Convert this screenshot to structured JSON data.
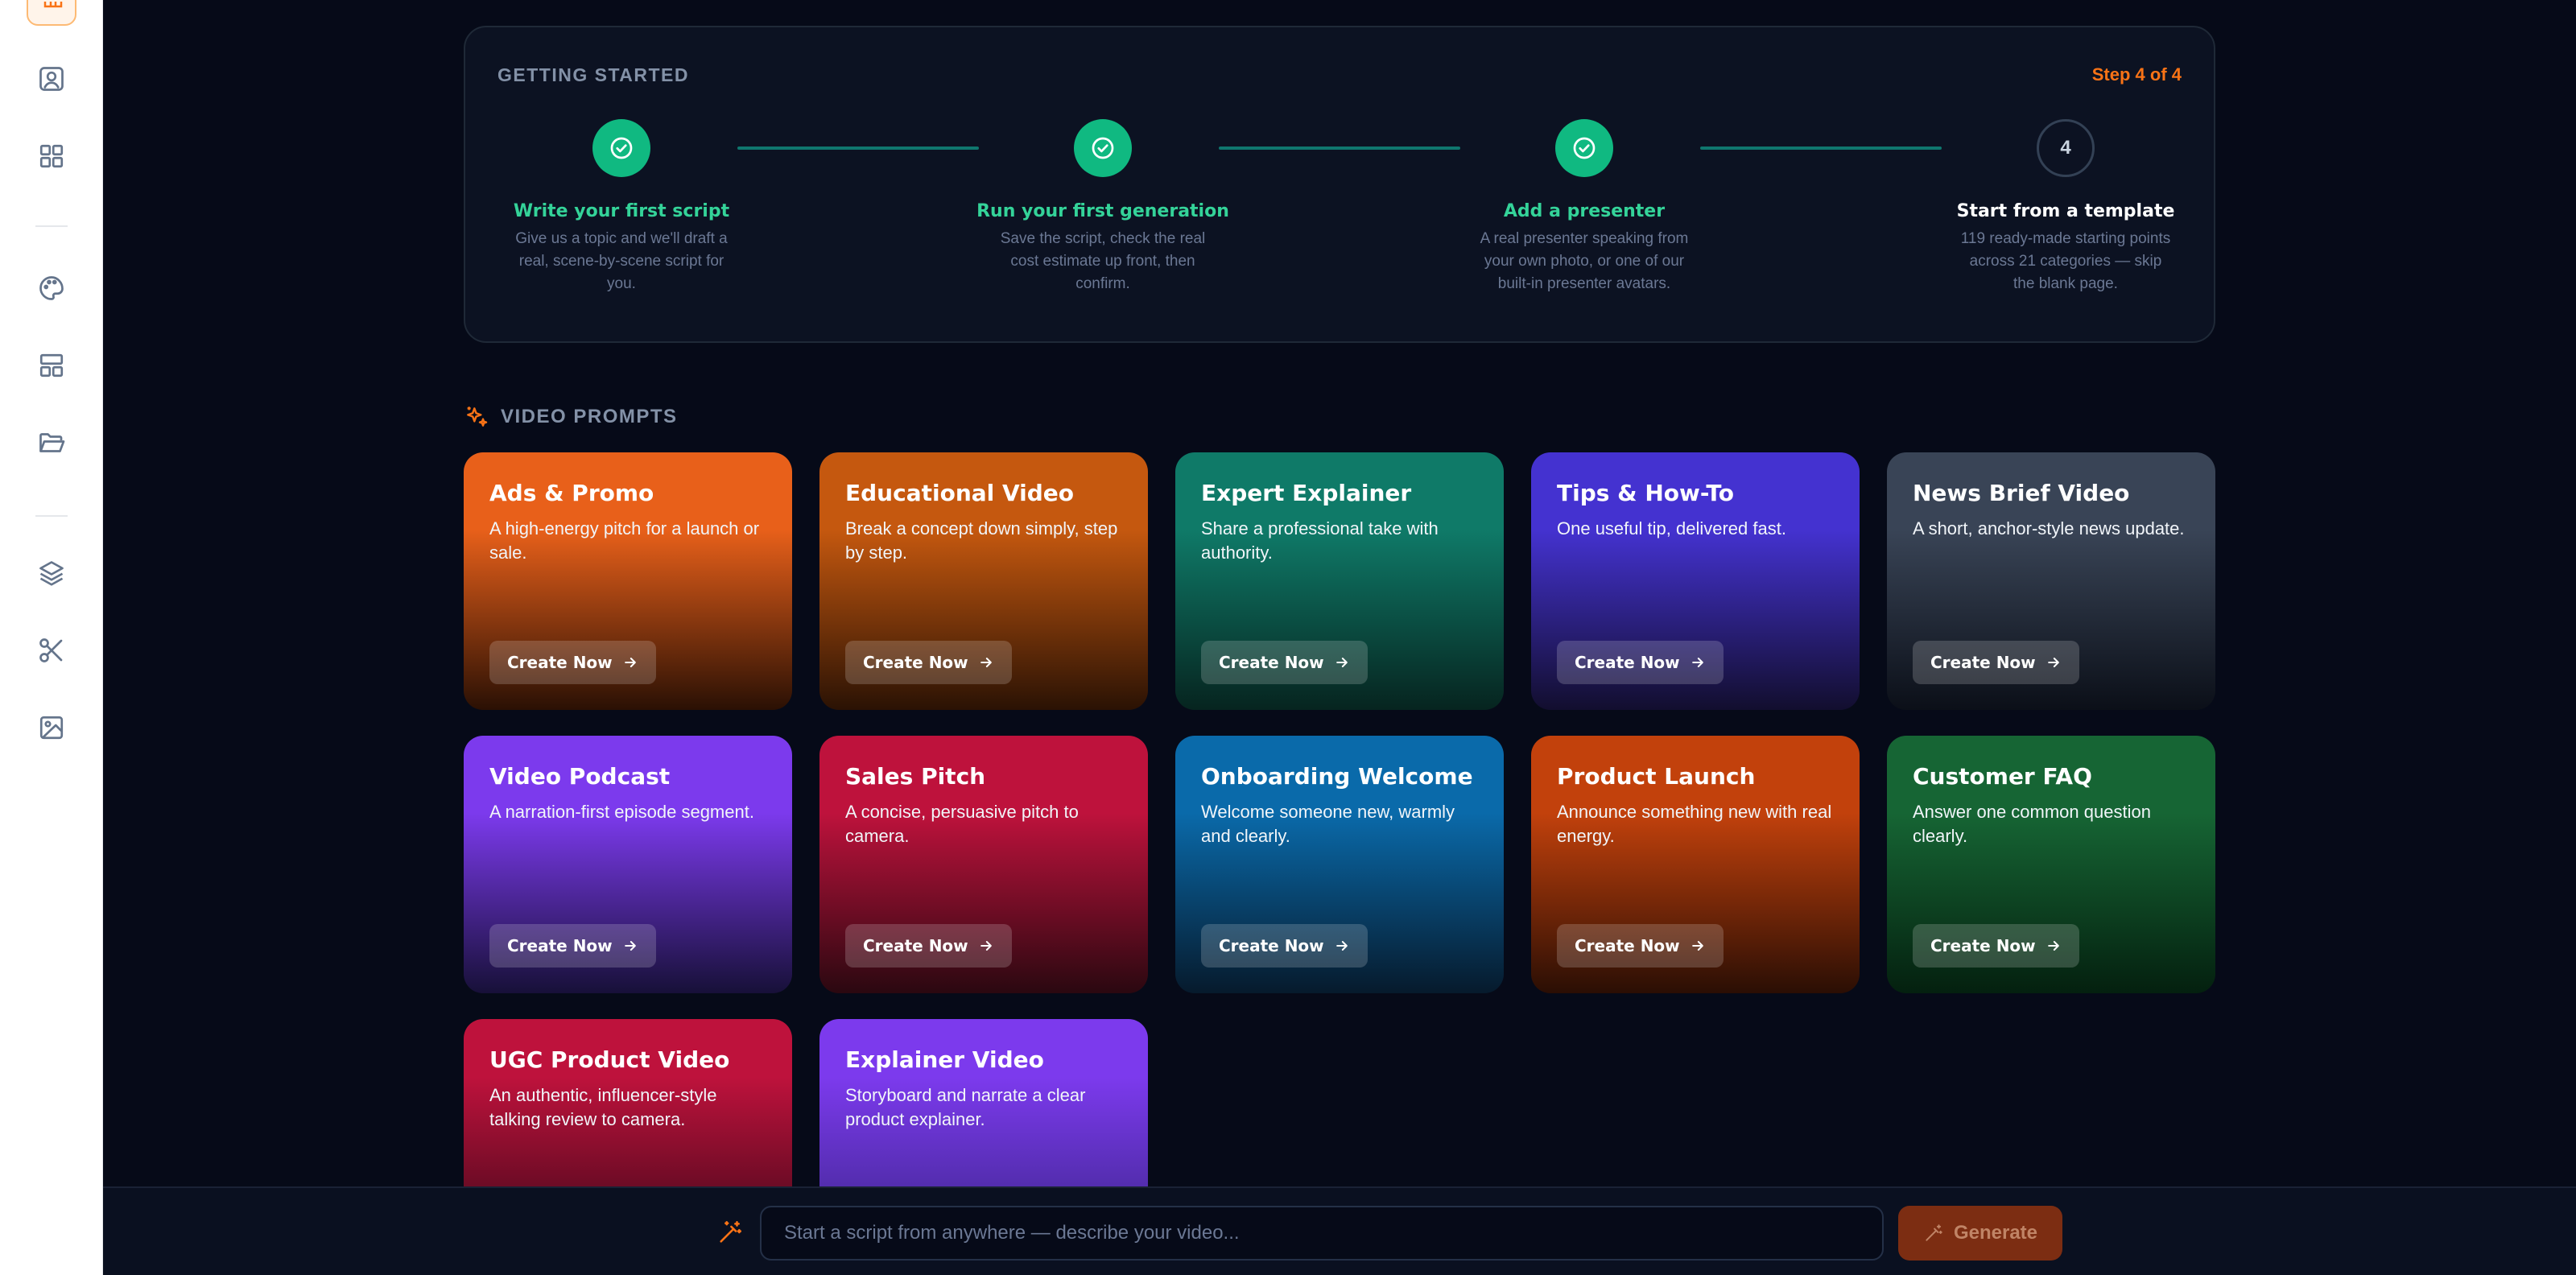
{
  "getting_started": {
    "title": "GETTING STARTED",
    "step_indicator": "Step 4 of 4",
    "steps": [
      {
        "label": "Write your first script",
        "desc": "Give us a topic and we'll draft a real, scene-by-scene script for you.",
        "status": "done"
      },
      {
        "label": "Run your first generation",
        "desc": "Save the script, check the real cost estimate up front, then confirm.",
        "status": "done"
      },
      {
        "label": "Add a presenter",
        "desc": "A real presenter speaking from your own photo, or one of our built-in presenter avatars.",
        "status": "done"
      },
      {
        "label": "Start from a template",
        "desc": "119 ready-made starting points across 21 categories — skip the blank page.",
        "status": "pending",
        "number": "4"
      }
    ]
  },
  "video_prompts": {
    "title": "VIDEO PROMPTS",
    "button_label": "Create Now",
    "cards": [
      {
        "title": "Ads & Promo",
        "desc": "A high-energy pitch for a launch or sale.",
        "color_top": "#e8601a",
        "color_bottom": "#2a1004"
      },
      {
        "title": "Educational Video",
        "desc": "Break a concept down simply, step by step.",
        "color_top": "#c5580f",
        "color_bottom": "#2a1204"
      },
      {
        "title": "Expert Explainer",
        "desc": "Share a professional take with authority.",
        "color_top": "#0f7a68",
        "color_bottom": "#06241f"
      },
      {
        "title": "Tips & How-To",
        "desc": "One useful tip, delivered fast.",
        "color_top": "#4432d0",
        "color_bottom": "#120e2e"
      },
      {
        "title": "News Brief Video",
        "desc": "A short, anchor-style news update.",
        "color_top": "#394456",
        "color_bottom": "#0b0f18"
      },
      {
        "title": "Video Podcast",
        "desc": "A narration-first episode segment.",
        "color_top": "#7c3aed",
        "color_bottom": "#171038"
      },
      {
        "title": "Sales Pitch",
        "desc": "A concise, persuasive pitch to camera.",
        "color_top": "#be123c",
        "color_bottom": "#2a0810"
      },
      {
        "title": "Onboarding Welcome",
        "desc": "Welcome someone new, warmly and clearly.",
        "color_top": "#0a6aaa",
        "color_bottom": "#061a2c"
      },
      {
        "title": "Product Launch",
        "desc": "Announce something new with real energy.",
        "color_top": "#c2410c",
        "color_bottom": "#2a0e04"
      },
      {
        "title": "Customer FAQ",
        "desc": "Answer one common question clearly.",
        "color_top": "#166534",
        "color_bottom": "#04200f"
      },
      {
        "title": "UGC Product Video",
        "desc": "An authentic, influencer-style talking review to camera.",
        "color_top": "#be123c",
        "color_bottom": "#5a0a20"
      },
      {
        "title": "Explainer Video",
        "desc": "Storyboard and narrate a clear product explainer.",
        "color_top": "#7c3aed",
        "color_bottom": "#4a2aa0"
      }
    ]
  },
  "bottom_bar": {
    "placeholder": "Start a script from anywhere — describe your video...",
    "generate_label": "Generate"
  },
  "sidebar": {
    "icons": [
      "grid-icon",
      "user-square-icon",
      "apps-icon",
      "palette-icon",
      "layout-icon",
      "folder-open-icon",
      "layers-icon",
      "scissors-icon",
      "image-icon"
    ]
  }
}
